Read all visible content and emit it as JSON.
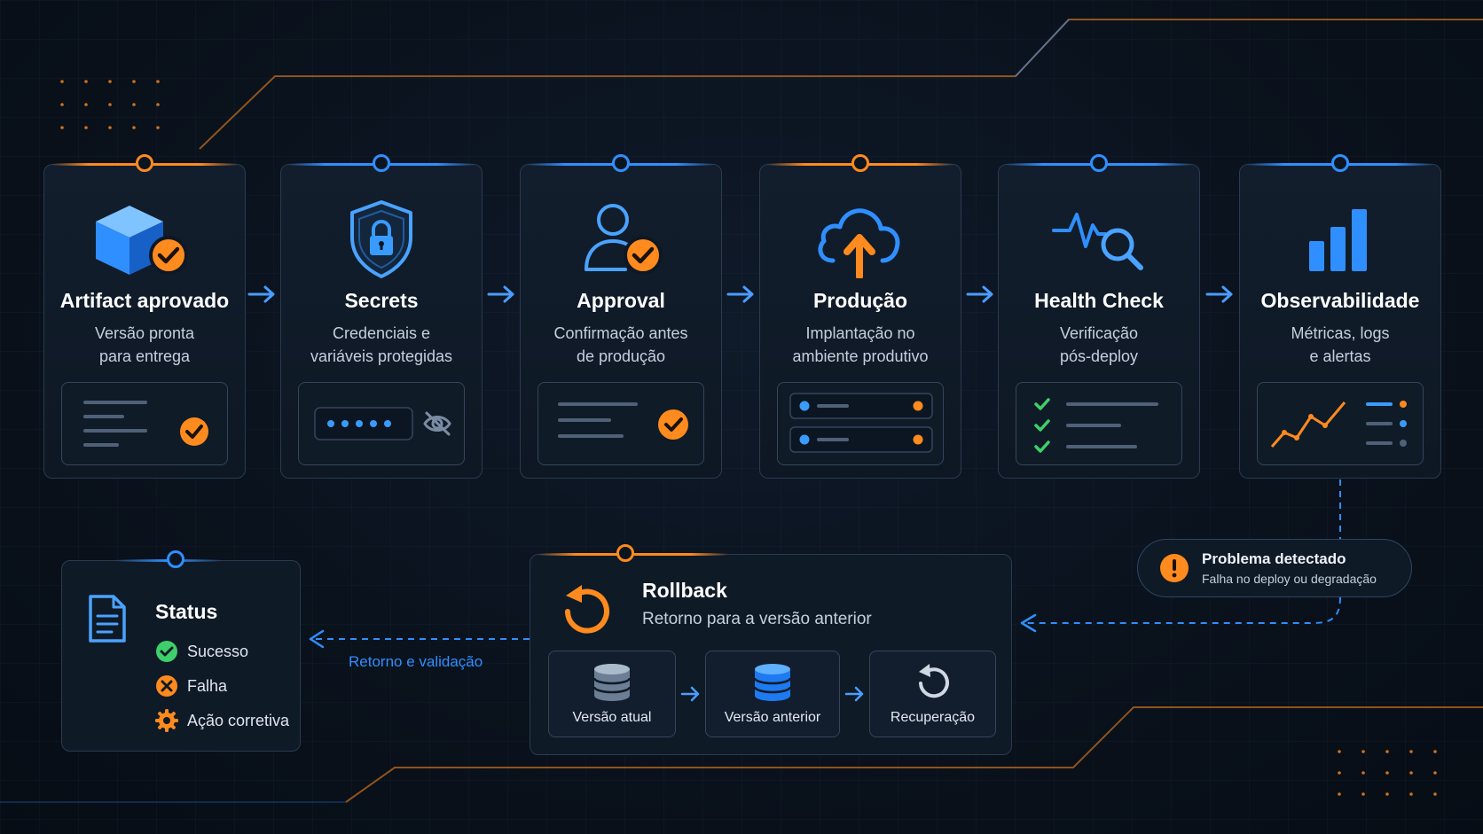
{
  "colors": {
    "accent_blue": "#2f8fff",
    "accent_orange": "#ff8a1e",
    "success_green": "#3fcf6a",
    "background": "#0a121d"
  },
  "steps": [
    {
      "title": "Artifact aprovado",
      "sub1": "Versão pronta",
      "sub2": "para entrega",
      "icon": "cube-check-icon",
      "accent": "orange"
    },
    {
      "title": "Secrets",
      "sub1": "Credenciais e",
      "sub2": "variáveis protegidas",
      "icon": "shield-lock-icon",
      "accent": "blue"
    },
    {
      "title": "Approval",
      "sub1": "Confirmação antes",
      "sub2": "de produção",
      "icon": "user-check-icon",
      "accent": "blue"
    },
    {
      "title": "Produção",
      "sub1": "Implantação no",
      "sub2": "ambiente produtivo",
      "icon": "cloud-upload-icon",
      "accent": "orange"
    },
    {
      "title": "Health Check",
      "sub1": "Verificação",
      "sub2": "pós-deploy",
      "icon": "pulse-search-icon",
      "accent": "blue"
    },
    {
      "title": "Observabilidade",
      "sub1": "Métricas, logs",
      "sub2": "e alertas",
      "icon": "bar-chart-icon",
      "accent": "blue"
    }
  ],
  "status": {
    "title": "Status",
    "items": [
      {
        "label": "Sucesso",
        "icon": "success-check-icon"
      },
      {
        "label": "Falha",
        "icon": "failure-x-icon"
      },
      {
        "label": "Ação corretiva",
        "icon": "gear-icon"
      }
    ]
  },
  "rollback": {
    "title": "Rollback",
    "subtitle": "Retorno para a versão anterior",
    "items": [
      {
        "label": "Versão atual",
        "icon": "database-gray-icon"
      },
      {
        "label": "Versão anterior",
        "icon": "database-blue-icon"
      },
      {
        "label": "Recuperação",
        "icon": "refresh-icon"
      }
    ]
  },
  "problem": {
    "title": "Problema detectado",
    "subtitle": "Falha no deploy ou degradação",
    "icon": "warning-icon"
  },
  "return_label": "Retorno e validação"
}
